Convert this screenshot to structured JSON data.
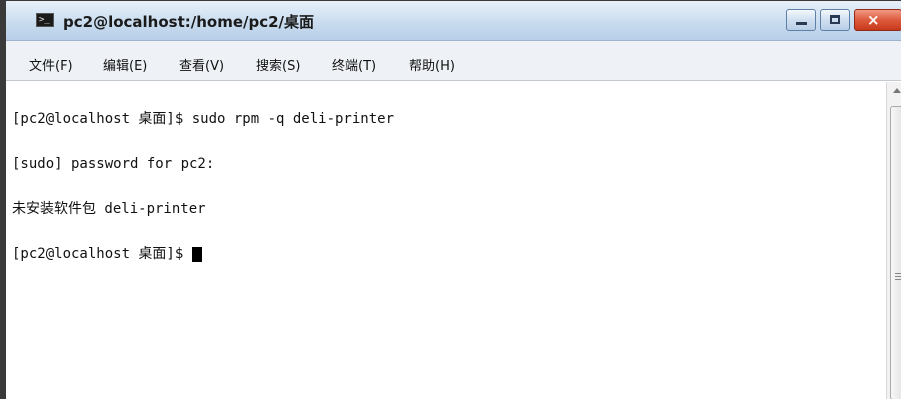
{
  "window": {
    "title": "pc2@localhost:/home/pc2/桌面",
    "icon": "terminal-icon",
    "controls": {
      "minimize": "minimize-icon",
      "maximize": "maximize-icon",
      "close": "×"
    }
  },
  "menubar": {
    "items": [
      {
        "label": "文件(F)"
      },
      {
        "label": "编辑(E)"
      },
      {
        "label": "查看(V)"
      },
      {
        "label": "搜索(S)"
      },
      {
        "label": "终端(T)"
      },
      {
        "label": "帮助(H)"
      }
    ]
  },
  "terminal": {
    "lines": [
      "[pc2@localhost 桌面]$ sudo rpm -q deli-printer",
      "[sudo] password for pc2:",
      "未安装软件包 deli-printer",
      "[pc2@localhost 桌面]$ "
    ]
  }
}
